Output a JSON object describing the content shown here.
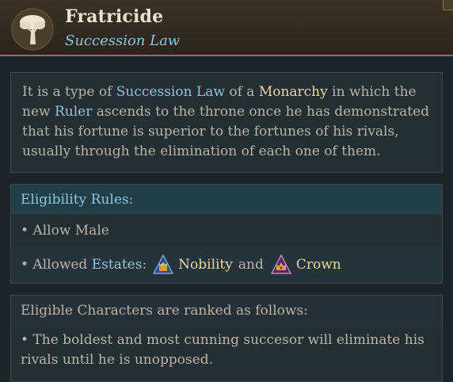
{
  "header": {
    "title": "Fratricide",
    "subtitle": "Succession Law",
    "icon": "tree-icon"
  },
  "description": {
    "t1": "It is a type of ",
    "l1": "Succession Law",
    "t2": " of a ",
    "l2": "Monarchy",
    "t3": " in which the new ",
    "l3": "Ruler",
    "t4": " ascends to the throne once he has demonstrated that his fortune is superior to the fortunes of his rivals, usually through the elimination of each one of them."
  },
  "eligibility": {
    "heading": "Eligibility Rules",
    "heading_colon": ":",
    "rule1": "• Allow Male",
    "rule2_prefix": "• Allowed ",
    "rule2_link": "Estates",
    "rule2_colon": ":",
    "estate1": "Nobility",
    "and": "and",
    "estate2": "Crown"
  },
  "ranking": {
    "heading": "Eligible Characters are ranked as follows:",
    "rule": "• The boldest and most cunning succesor will eliminate his rivals until he is unopposed."
  },
  "colors": {
    "link_blue": "#8fc6de",
    "gold": "#ecd79a",
    "header_border": "#8a7550"
  }
}
